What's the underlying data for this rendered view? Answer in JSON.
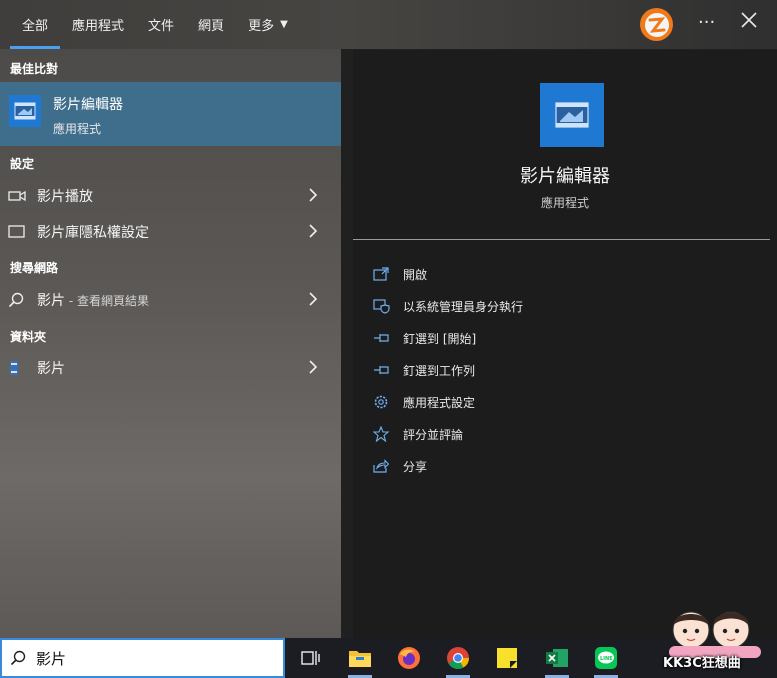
{
  "tabs": [
    {
      "label": "全部",
      "active": true
    },
    {
      "label": "應用程式",
      "active": false
    },
    {
      "label": "文件",
      "active": false
    },
    {
      "label": "網頁",
      "active": false
    },
    {
      "label": "更多",
      "active": false
    }
  ],
  "top_bar": {
    "more_icon": "ellipsis-icon",
    "close_icon": "close-icon"
  },
  "sections": {
    "best_match": "最佳比對",
    "settings": "設定",
    "web": "搜尋網路",
    "folders": "資料夾"
  },
  "best_match_item": {
    "name": "影片編輯器",
    "type": "應用程式"
  },
  "settings_items": [
    {
      "label": "影片播放"
    },
    {
      "label": "影片庫隱私權設定"
    }
  ],
  "web_item": {
    "label": "影片",
    "sub": " - 查看網頁結果"
  },
  "folder_item": {
    "label": "影片"
  },
  "detail": {
    "name": "影片編輯器",
    "type": "應用程式",
    "actions": [
      {
        "label": "開啟",
        "icon": "open-icon"
      },
      {
        "label": "以系統管理員身分執行",
        "icon": "admin-shield-icon"
      },
      {
        "label": "釘選到 [開始]",
        "icon": "pin-icon"
      },
      {
        "label": "釘選到工作列",
        "icon": "pin-icon"
      },
      {
        "label": "應用程式設定",
        "icon": "gear-icon"
      },
      {
        "label": "評分並評論",
        "icon": "star-icon"
      },
      {
        "label": "分享",
        "icon": "share-icon"
      }
    ]
  },
  "search": {
    "value": "影片"
  },
  "taskbar_apps": [
    "task-view-icon",
    "file-explorer-icon",
    "firefox-icon",
    "chrome-icon",
    "sticky-notes-icon",
    "excel-icon",
    "line-icon"
  ],
  "watermark": {
    "text": "KK3C狂想曲"
  },
  "colors": {
    "accent": "#4aa0f0",
    "selected_row": "#3f6d8c",
    "app_icon": "#1f78d1"
  }
}
